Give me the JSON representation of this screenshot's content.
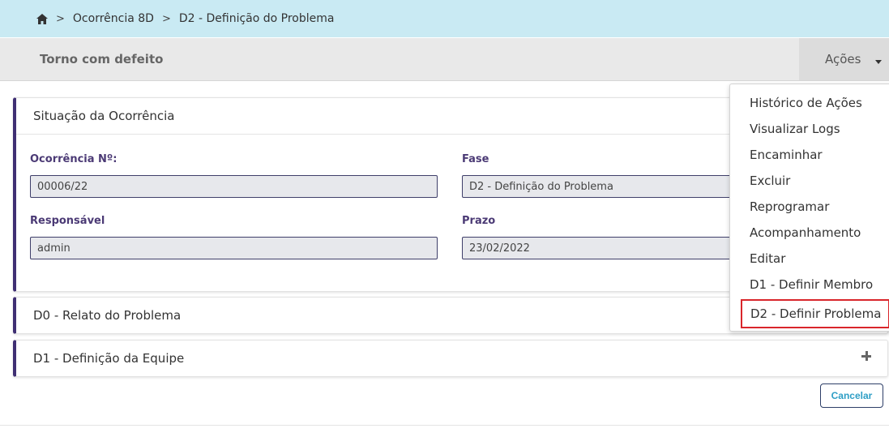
{
  "breadcrumb": {
    "home_icon": "home-icon",
    "separator": ">",
    "items": [
      "Ocorrência 8D",
      "D2 - Definição do Problema"
    ]
  },
  "header": {
    "title": "Torno com defeito",
    "actions_label": "Ações"
  },
  "situacao": {
    "title": "Situação da Ocorrência",
    "fields": {
      "ocorrencia_label": "Ocorrência Nº:",
      "ocorrencia_value": "00006/22",
      "fase_label": "Fase",
      "fase_value": "D2 - Definição do Problema",
      "responsavel_label": "Responsável",
      "responsavel_value": "admin",
      "prazo_label": "Prazo",
      "prazo_value": "23/02/2022"
    }
  },
  "sections": [
    {
      "title": "D0 - Relato do Problema"
    },
    {
      "title": "D1 - Definição da Equipe"
    }
  ],
  "buttons": {
    "cancel": "Cancelar"
  },
  "actions_menu": {
    "items": [
      "Histórico de Ações",
      "Visualizar Logs",
      "Encaminhar",
      "Excluir",
      "Reprogramar",
      "Acompanhamento",
      "Editar",
      "D1 - Definir Membro",
      "D2 - Definir Problema"
    ],
    "highlighted_item": "D2 - Definir Problema"
  },
  "colors": {
    "breadcrumb_bg": "#c9eaf3",
    "accent": "#3f2f73",
    "highlight": "#d9262b",
    "cancel_text": "#2e9ec5"
  }
}
